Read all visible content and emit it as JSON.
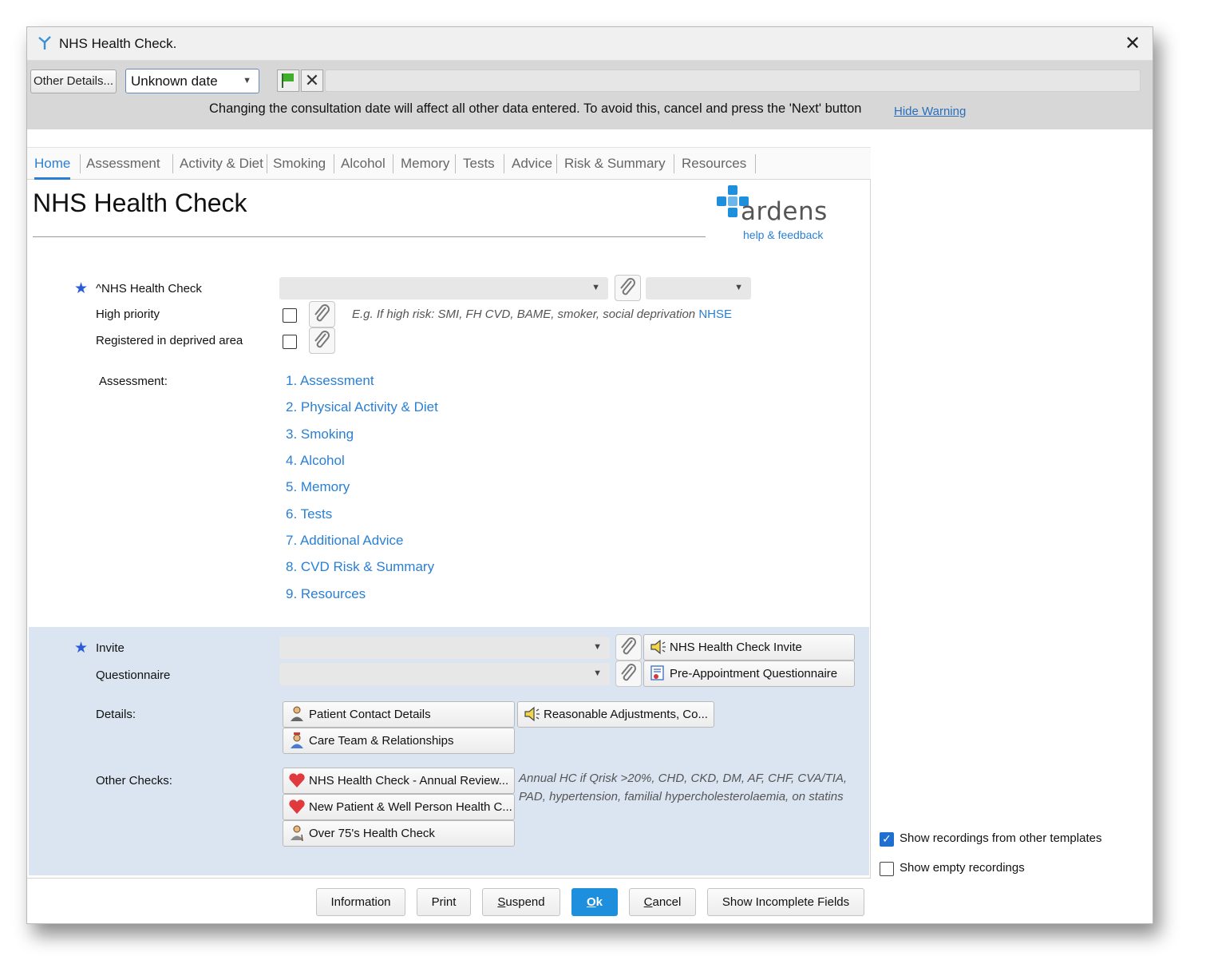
{
  "window": {
    "title": "NHS Health Check."
  },
  "toolbar": {
    "other_details_label": "Other Details...",
    "date_value": "Unknown date",
    "warning": "Changing the consultation date will affect all other data entered. To avoid this, cancel and press the 'Next' button",
    "hide_warning_label": "Hide Warning"
  },
  "tabs": [
    {
      "label": "Home",
      "active": true
    },
    {
      "label": "Assessment"
    },
    {
      "label": "Activity & Diet"
    },
    {
      "label": "Smoking"
    },
    {
      "label": "Alcohol"
    },
    {
      "label": "Memory"
    },
    {
      "label": "Tests"
    },
    {
      "label": "Advice"
    },
    {
      "label": "Risk & Summary"
    },
    {
      "label": "Resources"
    }
  ],
  "page": {
    "title": "NHS Health Check"
  },
  "logo": {
    "word": "ardens",
    "help": "help & feedback",
    "accent": "#1e8fdc"
  },
  "fields": {
    "nhs_health_check": "^NHS Health Check",
    "high_priority": "High priority",
    "deprived_area": "Registered in deprived area",
    "high_priority_hint": "E.g.  If high risk: SMI, FH CVD, BAME, smoker, social deprivation",
    "nhse_link": "NHSE"
  },
  "assessment": {
    "label": "Assessment:",
    "links": [
      "1. Assessment",
      "2. Physical Activity & Diet",
      "3. Smoking",
      "4. Alcohol",
      "5. Memory",
      "6. Tests",
      "7. Additional Advice",
      "8. CVD Risk & Summary",
      "9. Resources"
    ]
  },
  "lower": {
    "invite_label": "Invite",
    "questionnaire_label": "Questionnaire",
    "invite_button": "NHS Health Check Invite",
    "questionnaire_button": "Pre-Appointment Questionnaire",
    "details_label": "Details:",
    "details_buttons": [
      "Patient Contact Details",
      "Reasonable Adjustments, Co...",
      "Care Team & Relationships"
    ],
    "other_checks_label": "Other Checks:",
    "other_checks_buttons": [
      "NHS Health Check - Annual Review...",
      "New Patient & Well Person Health C...",
      "Over 75's Health Check"
    ],
    "other_checks_hint_1": "Annual HC if Qrisk >20%, CHD, CKD, DM, AF, CHF, CVA/TIA,",
    "other_checks_hint_2": "PAD, hypertension, familial hypercholesterolaemia, on statins"
  },
  "options": {
    "show_other_templates": "Show recordings from other templates",
    "show_other_templates_checked": true,
    "show_empty": "Show empty recordings",
    "show_empty_checked": false
  },
  "footer": {
    "information": "Information",
    "print": "Print",
    "suspend_first": "S",
    "suspend_rest": "uspend",
    "ok_first": "O",
    "ok_rest": "k",
    "cancel_first": "C",
    "cancel_rest": "ancel",
    "show_incomplete": "Show Incomplete Fields"
  }
}
